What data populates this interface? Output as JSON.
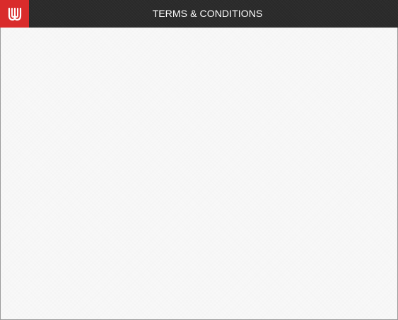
{
  "window": {
    "title": "TERMS & CONDITIONS",
    "logo_icon": "brand-logo-icon"
  },
  "colors": {
    "titlebar_bg": "#2b2b2b",
    "logo_bg": "#d92b2b",
    "title_text": "#ffffff",
    "content_bg": "#f8f8f8",
    "border": "#9a9a9a"
  },
  "content": {
    "text": ""
  }
}
